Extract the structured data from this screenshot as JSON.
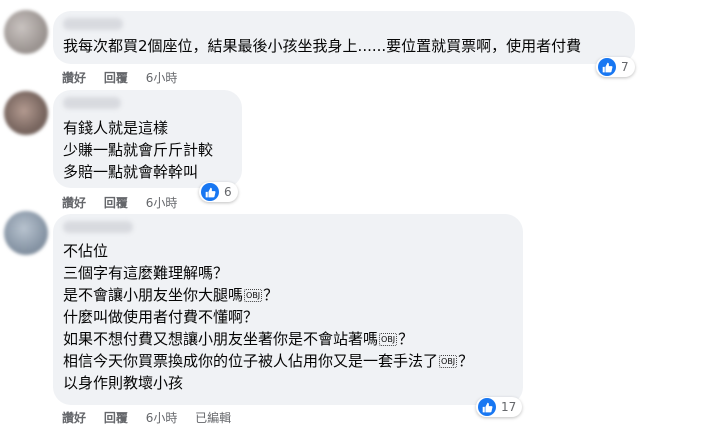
{
  "colors": {
    "bubble": "#f0f2f5",
    "like_blue": "#1877f2",
    "meta_gray": "#65676b"
  },
  "comments": [
    {
      "avatar_icon": "user-avatar",
      "lines": [
        "我每次都買2個座位，結果最後小孩坐我身上......要位置就買票啊，使用者付費"
      ],
      "actions": {
        "like": "讚好",
        "reply": "回覆",
        "time": "6小時"
      },
      "reaction_icon": "like-icon",
      "reaction_count": "7"
    },
    {
      "avatar_icon": "user-avatar",
      "lines": [
        "有錢人就是這樣",
        "少賺一點就會斤斤計較",
        "多賠一點就會幹幹叫"
      ],
      "actions": {
        "like": "讚好",
        "reply": "回覆",
        "time": "6小時"
      },
      "reaction_icon": "like-icon",
      "reaction_count": "6"
    },
    {
      "avatar_icon": "user-avatar",
      "lines": [
        "不佔位",
        "三個字有這麼難理解嗎？",
        "是不會讓小朋友坐你大腿嗎",
        "什麼叫做使用者付費不懂啊？",
        "如果不想付費又想讓小朋友坐著你是不會站著嗎",
        "相信今天你買票換成你的位子被人佔用你又是一套手法了",
        "以身作則教壞小孩"
      ],
      "line_suffix": [
        "",
        "",
        "？",
        "",
        "？",
        "？",
        ""
      ],
      "emoji_tags": [
        "",
        "",
        "OBJ",
        "",
        "OBJ",
        "OBJ",
        ""
      ],
      "actions": {
        "like": "讚好",
        "reply": "回覆",
        "time": "6小時",
        "edited": "已編輯"
      },
      "reaction_icon": "like-icon",
      "reaction_count": "17"
    }
  ]
}
